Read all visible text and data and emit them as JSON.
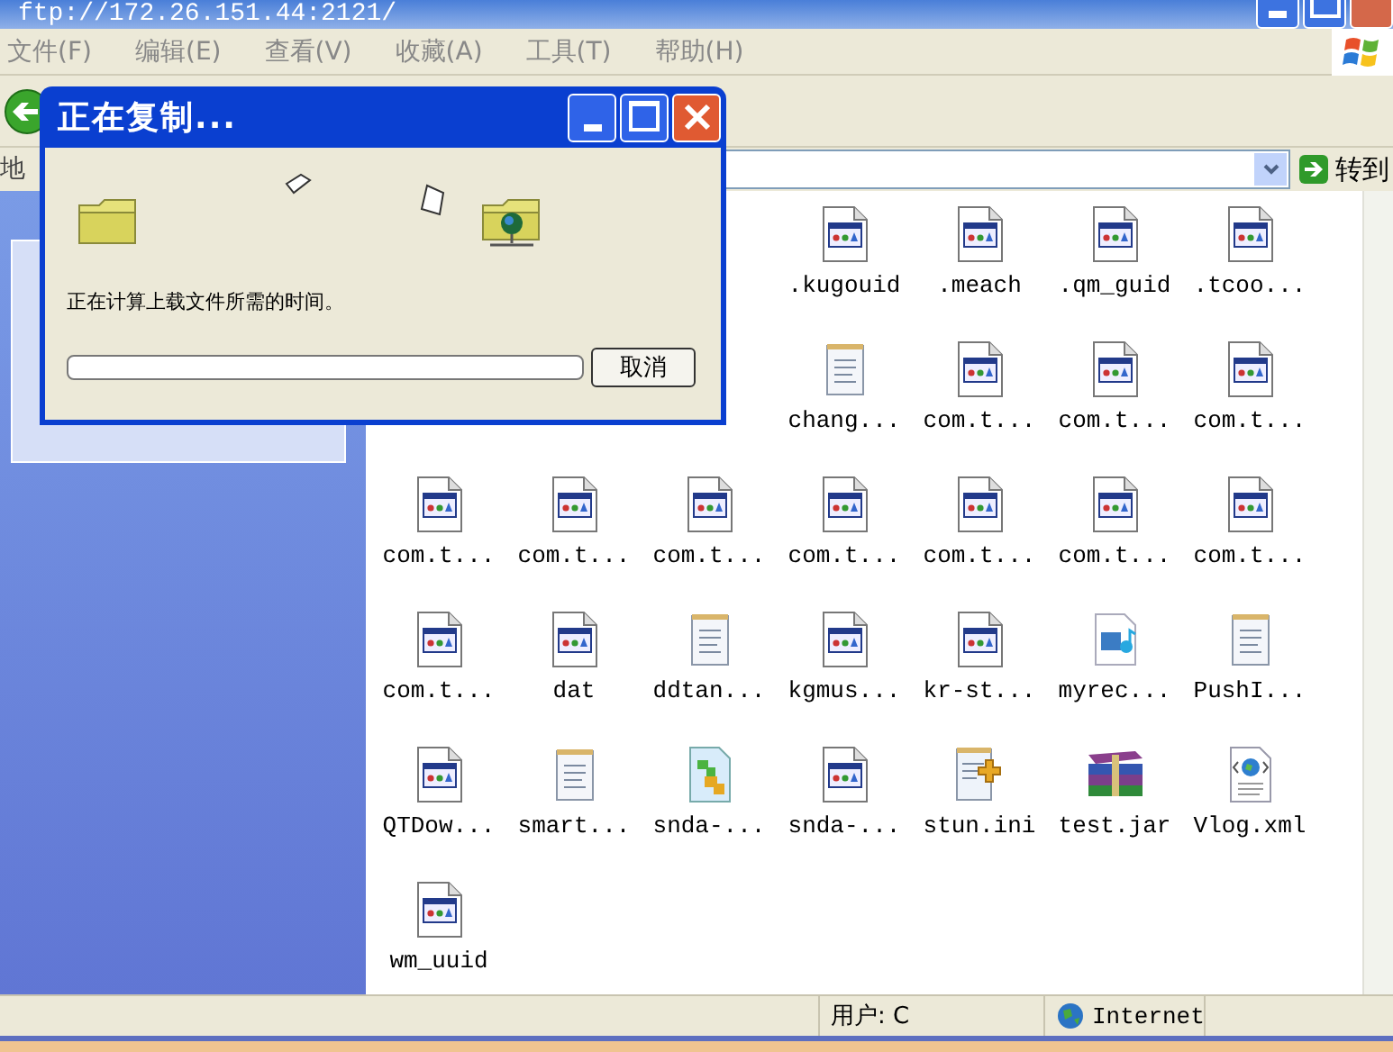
{
  "window": {
    "title": "ftp://172.26.151.44:2121/"
  },
  "menu": [
    "文件(F)",
    "编辑(E)",
    "查看(V)",
    "收藏(A)",
    "工具(T)",
    "帮助(H)"
  ],
  "address": {
    "label": "地",
    "go": "转到"
  },
  "files": [
    [
      {
        "name": ".kugouid",
        "kind": "app"
      },
      {
        "name": ".meach",
        "kind": "app"
      },
      {
        "name": ".qm_guid",
        "kind": "app"
      },
      {
        "name": ".tcoo...",
        "kind": "app"
      }
    ],
    [
      {
        "name": "chang...",
        "kind": "text"
      },
      {
        "name": "com.t...",
        "kind": "app"
      },
      {
        "name": "com.t...",
        "kind": "app"
      },
      {
        "name": "com.t...",
        "kind": "app"
      }
    ],
    [
      {
        "name": "com.t...",
        "kind": "app"
      },
      {
        "name": "com.t...",
        "kind": "app"
      },
      {
        "name": "com.t...",
        "kind": "app"
      },
      {
        "name": "com.t...",
        "kind": "app"
      },
      {
        "name": "com.t...",
        "kind": "app"
      },
      {
        "name": "com.t...",
        "kind": "app"
      },
      {
        "name": "com.t...",
        "kind": "app"
      }
    ],
    [
      {
        "name": "com.t...",
        "kind": "app"
      },
      {
        "name": "dat",
        "kind": "app"
      },
      {
        "name": "ddtan...",
        "kind": "text"
      },
      {
        "name": "kgmus...",
        "kind": "app"
      },
      {
        "name": "kr-st...",
        "kind": "app"
      },
      {
        "name": "myrec...",
        "kind": "media"
      },
      {
        "name": "PushI...",
        "kind": "text"
      }
    ],
    [
      {
        "name": "QTDow...",
        "kind": "app"
      },
      {
        "name": "smart...",
        "kind": "text"
      },
      {
        "name": "snda-...",
        "kind": "config"
      },
      {
        "name": "snda-...",
        "kind": "app"
      },
      {
        "name": "stun.ini",
        "kind": "ini"
      },
      {
        "name": "test.jar",
        "kind": "archive"
      },
      {
        "name": "Vlog.xml",
        "kind": "xml"
      }
    ],
    [
      {
        "name": "wm_uuid",
        "kind": "app"
      }
    ]
  ],
  "dialog": {
    "title": "正在复制...",
    "message": "正在计算上载文件所需的时间。",
    "progress": {
      "level": 0
    },
    "cancel": "取消"
  },
  "status_bar": {
    "user": "用户: C",
    "zone": "Internet"
  }
}
